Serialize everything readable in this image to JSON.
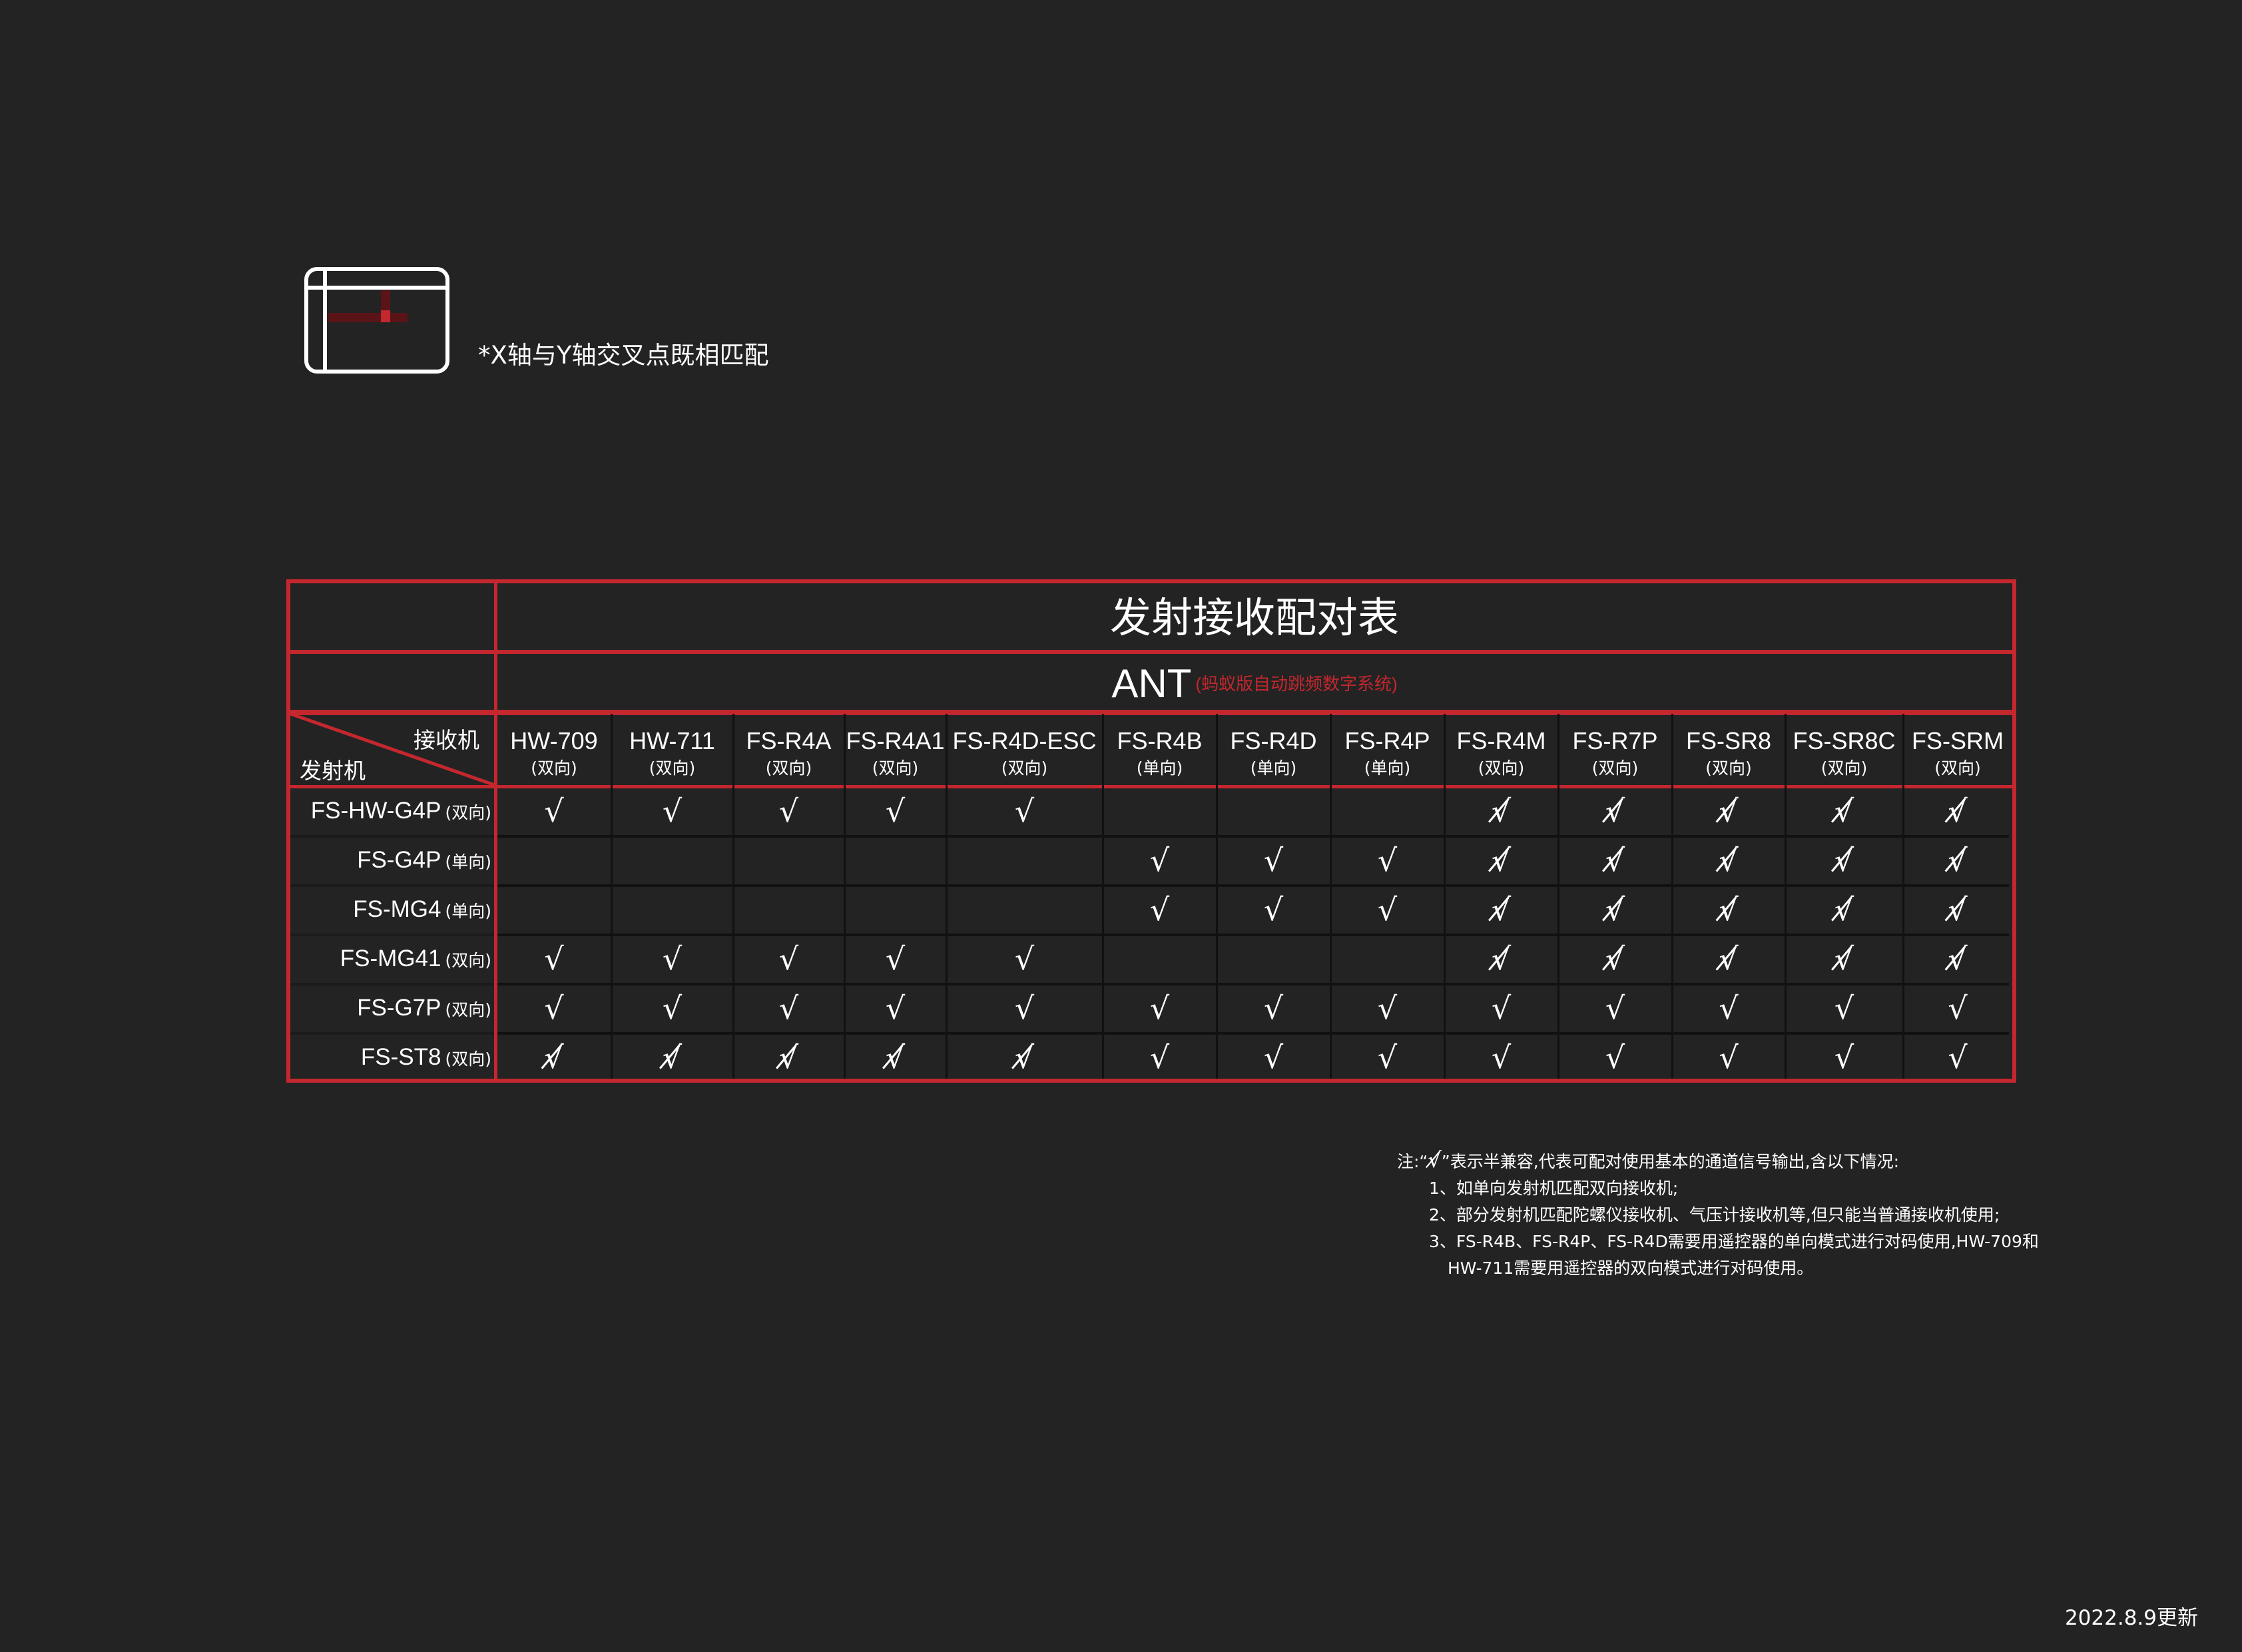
{
  "legend": {
    "icon": "crosshair-grid-icon",
    "text": "*X轴与Y轴交叉点既相匹配"
  },
  "table": {
    "title": "发射接收配对表",
    "brand": "ANT",
    "brand_sub": "(蚂蚁版自动跳频数字系统)",
    "corner_receiver": "接收机",
    "corner_transmitter": "发射机",
    "colors": {
      "accent": "#c4272e",
      "background": "#232323",
      "text": "#ffffff"
    },
    "columns": [
      {
        "model": "HW-709",
        "dir": "(双向)"
      },
      {
        "model": "HW-711",
        "dir": "(双向)"
      },
      {
        "model": "FS-R4A",
        "dir": "(双向)"
      },
      {
        "model": "FS-R4A1",
        "dir": "(双向)"
      },
      {
        "model": "FS-R4D-ESC",
        "dir": "(双向)"
      },
      {
        "model": "FS-R4B",
        "dir": "(单向)"
      },
      {
        "model": "FS-R4D",
        "dir": "(单向)"
      },
      {
        "model": "FS-R4P",
        "dir": "(单向)"
      },
      {
        "model": "FS-R4M",
        "dir": "(双向)"
      },
      {
        "model": "FS-R7P",
        "dir": "(双向)"
      },
      {
        "model": "FS-SR8",
        "dir": "(双向)"
      },
      {
        "model": "FS-SR8C",
        "dir": "(双向)"
      },
      {
        "model": "FS-SRM",
        "dir": "(双向)"
      }
    ],
    "rows": [
      {
        "model": "FS-HW-G4P",
        "dir": "(双向)",
        "cells": [
          "√",
          "√",
          "√",
          "√",
          "√",
          "",
          "",
          "",
          "√̸",
          "√̸",
          "√̸",
          "√̸",
          "√̸"
        ]
      },
      {
        "model": "FS-G4P",
        "dir": "(单向)",
        "cells": [
          "",
          "",
          "",
          "",
          "",
          "√",
          "√",
          "√",
          "√̸",
          "√̸",
          "√̸",
          "√̸",
          "√̸"
        ]
      },
      {
        "model": "FS-MG4",
        "dir": "(单向)",
        "cells": [
          "",
          "",
          "",
          "",
          "",
          "√",
          "√",
          "√",
          "√̸",
          "√̸",
          "√̸",
          "√̸",
          "√̸"
        ]
      },
      {
        "model": "FS-MG41",
        "dir": "(双向)",
        "cells": [
          "√",
          "√",
          "√",
          "√",
          "√",
          "",
          "",
          "",
          "√̸",
          "√̸",
          "√̸",
          "√̸",
          "√̸"
        ]
      },
      {
        "model": "FS-G7P",
        "dir": "(双向)",
        "cells": [
          "√",
          "√",
          "√",
          "√",
          "√",
          "√",
          "√",
          "√",
          "√",
          "√",
          "√",
          "√",
          "√"
        ]
      },
      {
        "model": "FS-ST8",
        "dir": "(双向)",
        "cells": [
          "√̸",
          "√̸",
          "√̸",
          "√̸",
          "√̸",
          "√",
          "√",
          "√",
          "√",
          "√",
          "√",
          "√",
          "√"
        ]
      }
    ]
  },
  "notes": {
    "intro_a": "注:“",
    "intro_mark": "√̸",
    "intro_b": "”表示半兼容,代表可配对使用基本的通道信号输出,含以下情况:",
    "items": [
      "1、如单向发射机匹配双向接收机;",
      "2、部分发射机匹配陀螺仪接收机、气压计接收机等,但只能当普通接收机使用;",
      "3、FS-R4B、FS-R4P、FS-R4D需要用遥控器的单向模式进行对码使用,HW-709和"
    ],
    "item3_cont": "HW-711需要用遥控器的双向模式进行对码使用。"
  },
  "update_date": "2022.8.9更新"
}
